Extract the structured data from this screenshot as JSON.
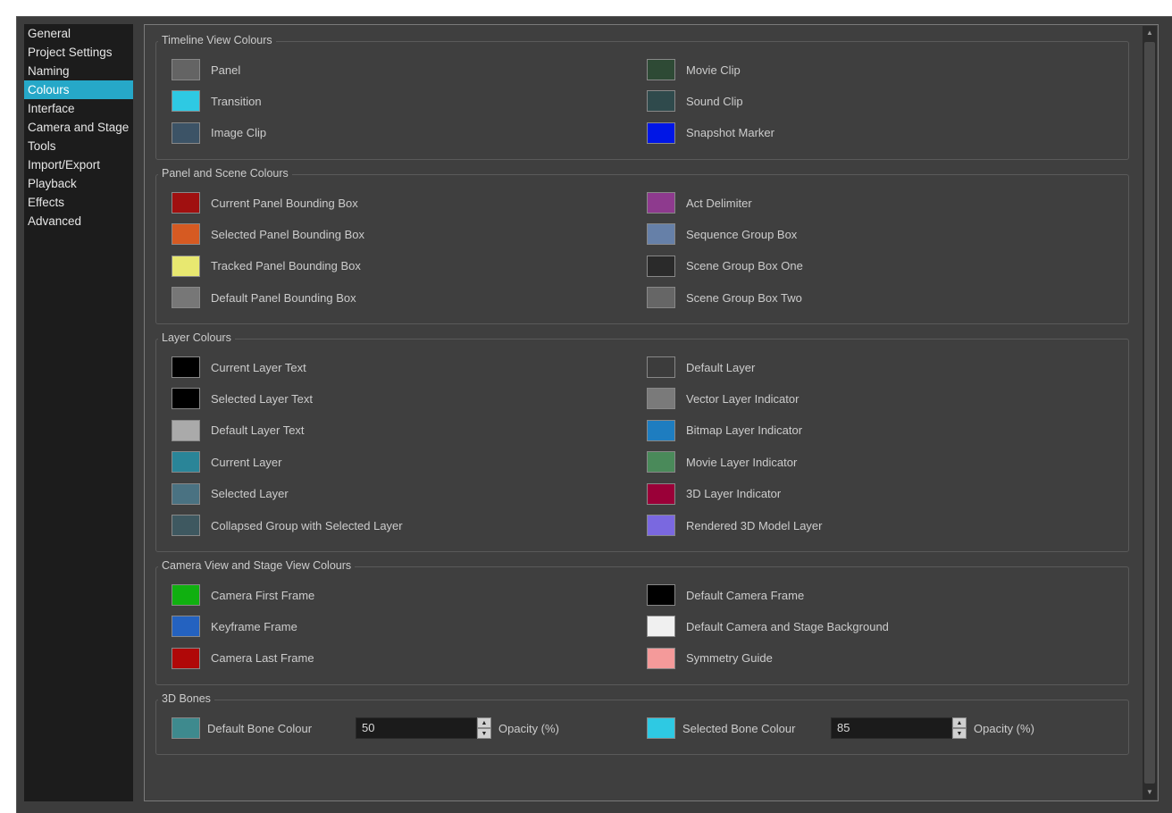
{
  "sidebar": {
    "items": [
      {
        "label": "General",
        "active": false
      },
      {
        "label": "Project Settings",
        "active": false
      },
      {
        "label": "Naming",
        "active": false
      },
      {
        "label": "Colours",
        "active": true
      },
      {
        "label": "Interface",
        "active": false
      },
      {
        "label": "Camera and Stage",
        "active": false
      },
      {
        "label": "Tools",
        "active": false
      },
      {
        "label": "Import/Export",
        "active": false
      },
      {
        "label": "Playback",
        "active": false
      },
      {
        "label": "Effects",
        "active": false
      },
      {
        "label": "Advanced",
        "active": false
      }
    ]
  },
  "groups": {
    "timeline": {
      "title": "Timeline View Colours",
      "left": [
        {
          "label": "Panel",
          "color": "#646464"
        },
        {
          "label": "Transition",
          "color": "#2ec9e3"
        },
        {
          "label": "Image Clip",
          "color": "#3c5366"
        }
      ],
      "right": [
        {
          "label": "Movie Clip",
          "color": "#2e4a35"
        },
        {
          "label": "Sound Clip",
          "color": "#2f4a4c"
        },
        {
          "label": "Snapshot Marker",
          "color": "#0016e6"
        }
      ]
    },
    "panel_scene": {
      "title": "Panel and Scene Colours",
      "left": [
        {
          "label": "Current Panel Bounding Box",
          "color": "#a01010"
        },
        {
          "label": "Selected Panel Bounding Box",
          "color": "#d65a22"
        },
        {
          "label": "Tracked Panel Bounding Box",
          "color": "#e8e870"
        },
        {
          "label": "Default Panel Bounding Box",
          "color": "#777777"
        }
      ],
      "right": [
        {
          "label": "Act Delimiter",
          "color": "#8e3a8e"
        },
        {
          "label": "Sequence Group Box",
          "color": "#6680a8"
        },
        {
          "label": "Scene Group Box One",
          "color": "#2a2a2a"
        },
        {
          "label": "Scene Group Box Two",
          "color": "#666666"
        }
      ]
    },
    "layer": {
      "title": "Layer Colours",
      "left": [
        {
          "label": "Current Layer Text",
          "color": "#000000"
        },
        {
          "label": "Selected Layer Text",
          "color": "#000000"
        },
        {
          "label": "Default Layer Text",
          "color": "#aaaaaa"
        },
        {
          "label": "Current Layer",
          "color": "#2a8598"
        },
        {
          "label": "Selected Layer",
          "color": "#4a7282"
        },
        {
          "label": "Collapsed Group with Selected Layer",
          "color": "#3e5860"
        }
      ],
      "right": [
        {
          "label": "Default Layer",
          "color": "#3c3c3c"
        },
        {
          "label": "Vector Layer Indicator",
          "color": "#7a7a7a"
        },
        {
          "label": "Bitmap Layer Indicator",
          "color": "#1e7dc0"
        },
        {
          "label": "Movie Layer Indicator",
          "color": "#4a8a5a"
        },
        {
          "label": "3D Layer Indicator",
          "color": "#9a0038"
        },
        {
          "label": "Rendered 3D Model Layer",
          "color": "#7a68e0"
        }
      ]
    },
    "camera": {
      "title": "Camera View and Stage View Colours",
      "left": [
        {
          "label": "Camera First Frame",
          "color": "#10b010"
        },
        {
          "label": "Keyframe Frame",
          "color": "#2462c0"
        },
        {
          "label": "Camera Last Frame",
          "color": "#b00808"
        }
      ],
      "right": [
        {
          "label": "Default Camera Frame",
          "color": "#000000"
        },
        {
          "label": "Default Camera and Stage Background",
          "color": "#f0f0f0"
        },
        {
          "label": "Symmetry Guide",
          "color": "#f49a9a"
        }
      ]
    },
    "bones": {
      "title": "3D Bones",
      "default_label": "Default Bone Colour",
      "default_color": "#3e8a8e",
      "default_opacity": "50",
      "selected_label": "Selected Bone Colour",
      "selected_color": "#2ec9e3",
      "selected_opacity": "85",
      "opacity_label": "Opacity (%)"
    }
  }
}
